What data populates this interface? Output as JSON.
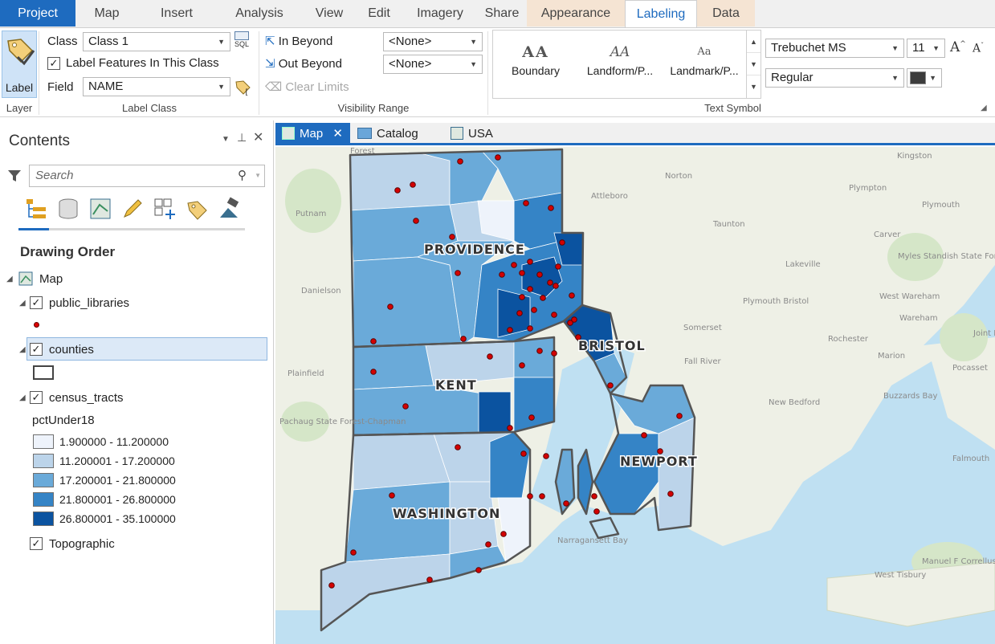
{
  "ribbon_tabs": [
    {
      "label": "Project"
    },
    {
      "label": "Map"
    },
    {
      "label": "Insert"
    },
    {
      "label": "Analysis"
    },
    {
      "label": "View"
    },
    {
      "label": "Edit"
    },
    {
      "label": "Imagery"
    },
    {
      "label": "Share"
    },
    {
      "label": "Appearance"
    },
    {
      "label": "Labeling"
    },
    {
      "label": "Data"
    }
  ],
  "active_tab": "Labeling",
  "layer_group": {
    "label_button": "Label",
    "group_label": "Layer"
  },
  "label_class_group": {
    "class_label": "Class",
    "class_value": "Class 1",
    "sql_text": "SQL",
    "label_features_text": "Label Features In This Class",
    "label_features_checked": true,
    "field_label": "Field",
    "field_value": "NAME",
    "group_label": "Label Class"
  },
  "visibility_group": {
    "in_beyond": "In Beyond",
    "out_beyond": "Out Beyond",
    "clear_limits": "Clear Limits",
    "in_beyond_value": "<None>",
    "out_beyond_value": "<None>",
    "group_label": "Visibility Range"
  },
  "text_symbol_group": {
    "gallery": [
      {
        "glyph": "AA",
        "name": "Boundary"
      },
      {
        "glyph": "AA",
        "name": "Landform/P..."
      },
      {
        "glyph": "Aa",
        "name": "Landmark/P..."
      }
    ],
    "font_value": "Trebuchet MS",
    "size_value": "11",
    "style_value": "Regular",
    "color": "#3c3c3c",
    "group_label": "Text Symbol"
  },
  "contents": {
    "title": "Contents",
    "search_placeholder": "Search",
    "drawing_order": "Drawing Order",
    "map_item": "Map",
    "layers": {
      "public_libraries": "public_libraries",
      "counties": "counties",
      "census_tracts": "census_tracts",
      "field": "pctUnder18",
      "topographic": "Topographic"
    },
    "legend": [
      {
        "label": "1.900000 - 11.200000",
        "color": "#eef3fb"
      },
      {
        "label": "11.200001 - 17.200000",
        "color": "#bcd4ea"
      },
      {
        "label": "17.200001 - 21.800000",
        "color": "#6aaad9"
      },
      {
        "label": "21.800001 - 26.800000",
        "color": "#3584c6"
      },
      {
        "label": "26.800001 - 35.100000",
        "color": "#0b53a0"
      }
    ]
  },
  "map_tabs": [
    {
      "label": "Map"
    },
    {
      "label": "Catalog"
    },
    {
      "label": "USA"
    }
  ],
  "map": {
    "county_labels": [
      "PROVIDENCE",
      "BRISTOL",
      "KENT",
      "NEWPORT",
      "WASHINGTON"
    ],
    "places": [
      "Kingston",
      "Norton",
      "Plympton",
      "Attleboro",
      "Plymouth",
      "Putnam",
      "Taunton",
      "Carver",
      "Myles Standish State Forest",
      "Lakeville",
      "Danielson",
      "Plymouth Bristol",
      "West Wareham",
      "Wareham",
      "Somerset",
      "Rochester",
      "Fall River",
      "Marion",
      "Plainfield",
      "Pocasset",
      "Buzzards Bay",
      "New Bedford",
      "Pachaug State Forest-Chapman",
      "Falmouth",
      "Narragansett Bay",
      "West Tisbury",
      "Manuel F Correllus State Forest",
      "Forest",
      "Joint Base Cape Cod"
    ]
  }
}
